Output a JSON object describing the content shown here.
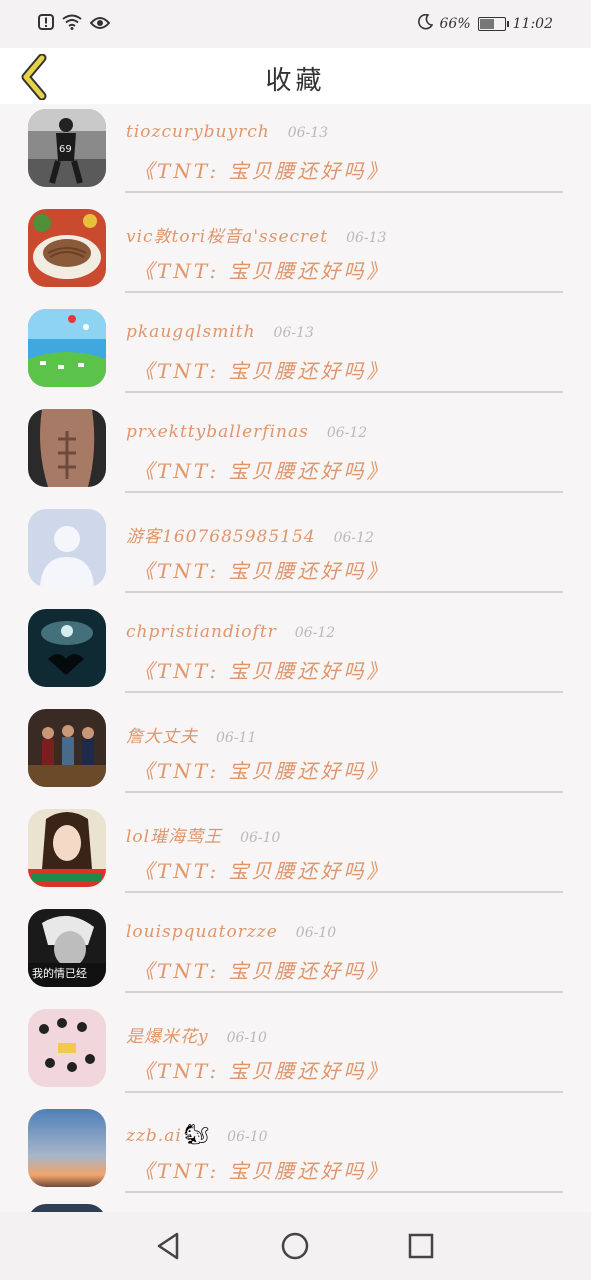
{
  "status_bar": {
    "left_icons": [
      "alert-icon",
      "wifi-icon",
      "eye-icon"
    ],
    "moon_icon": "moon-icon",
    "battery_percent": "66%",
    "battery_level": 0.66,
    "time": "11:02"
  },
  "header": {
    "title": "收藏",
    "back_icon": "chevron-left-icon",
    "accent_color": "#e6d34a"
  },
  "items": [
    {
      "username": "tiozcurybuyrch",
      "date": "06-13",
      "subtitle": "《TNT: 宝贝腰还好吗》",
      "avatar": "photo-bw-figure"
    },
    {
      "username": "vic敦tori桜音a'ssecret",
      "date": "06-13",
      "subtitle": "《TNT: 宝贝腰还好吗》",
      "avatar": "photo-noodles"
    },
    {
      "username": "pkaugqlsmith",
      "date": "06-13",
      "subtitle": "《TNT: 宝贝腰还好吗》",
      "avatar": "photo-meadow"
    },
    {
      "username": "prxekttyballerfinas",
      "date": "06-12",
      "subtitle": "《TNT: 宝贝腰还好吗》",
      "avatar": "photo-abs"
    },
    {
      "username": "游客1607685985154",
      "date": "06-12",
      "subtitle": "《TNT: 宝贝腰还好吗》",
      "avatar": "default-avatar"
    },
    {
      "username": "chpristiandioftr",
      "date": "06-12",
      "subtitle": "《TNT: 宝贝腰还好吗》",
      "avatar": "photo-night-sky"
    },
    {
      "username": "詹大丈夫",
      "date": "06-11",
      "subtitle": "《TNT: 宝贝腰还好吗》",
      "avatar": "photo-group"
    },
    {
      "username": "lol璀海莺王",
      "date": "06-10",
      "subtitle": "《TNT: 宝贝腰还好吗》",
      "avatar": "photo-girl"
    },
    {
      "username": "louispquatorzze",
      "date": "06-10",
      "subtitle": "《TNT: 宝贝腰还好吗》",
      "avatar": "photo-bw-boy",
      "avatar_caption": "我的情已经"
    },
    {
      "username": "是爆米花y",
      "date": "06-10",
      "subtitle": "《TNT: 宝贝腰还好吗》",
      "avatar": "photo-cartoon"
    },
    {
      "username": "zzb.ai",
      "date": "06-10",
      "subtitle": "《TNT: 宝贝腰还好吗》",
      "avatar": "photo-sunset",
      "emoji": "🐿"
    }
  ],
  "nav_bar": {
    "back_icon": "triangle-back-icon",
    "home_icon": "circle-home-icon",
    "recents_icon": "square-recents-icon"
  }
}
